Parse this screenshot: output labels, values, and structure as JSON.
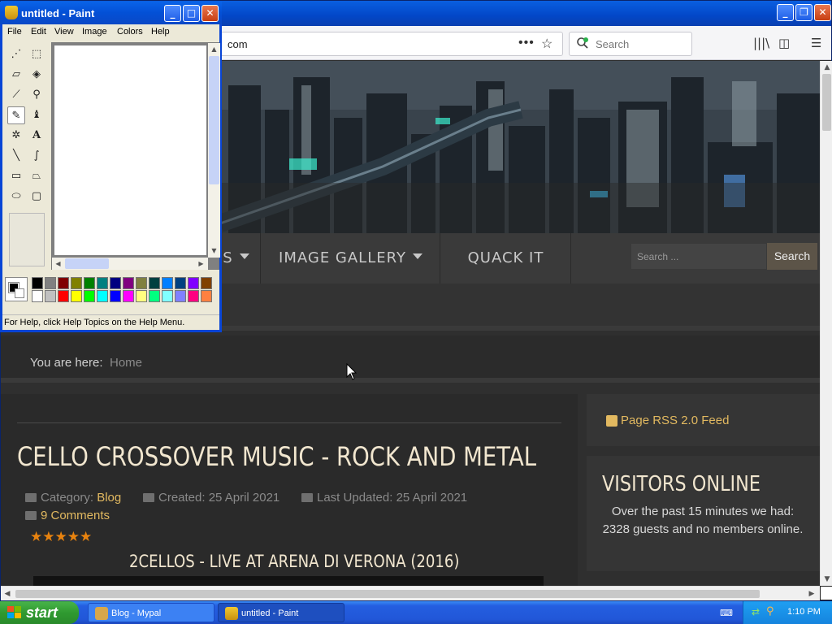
{
  "browser": {
    "url": "com",
    "search_placeholder": "Search"
  },
  "site": {
    "nav": [
      {
        "label": "S",
        "has_dropdown": true
      },
      {
        "label": "IMAGE GALLERY",
        "has_dropdown": true
      },
      {
        "label": "QUACK IT",
        "has_dropdown": false
      }
    ],
    "search_placeholder": "Search ...",
    "search_button": "Search",
    "breadcrumb": {
      "prefix": "You are here:",
      "home": "Home"
    },
    "article": {
      "title": "CELLO CROSSOVER MUSIC - ROCK AND METAL",
      "category_label": "Category:",
      "category_value": "Blog",
      "created": "Created: 25 April 2021",
      "updated": "Last Updated: 25 April 2021",
      "comments": "9 Comments",
      "rating_stars": 5,
      "video_title": "2CELLOS - LIVE AT ARENA DI VERONA (2016)"
    },
    "sidebar": {
      "rss": "Page RSS 2.0 Feed",
      "visitors_title": "VISITORS ONLINE",
      "visitors_text": "Over the past 15 minutes we had: 2328 guests and no members online."
    }
  },
  "paint": {
    "title": "untitled - Paint",
    "menu": [
      "File",
      "Edit",
      "View",
      "Image",
      "Colors",
      "Help"
    ],
    "status": "For Help, click Help Topics on the Help Menu.",
    "palette_top": [
      "#000000",
      "#808080",
      "#800000",
      "#808000",
      "#008000",
      "#008080",
      "#000080",
      "#800080",
      "#808040",
      "#004040",
      "#0080ff",
      "#004080",
      "#8000ff",
      "#804000"
    ],
    "palette_bottom": [
      "#ffffff",
      "#c0c0c0",
      "#ff0000",
      "#ffff00",
      "#00ff00",
      "#00ffff",
      "#0000ff",
      "#ff00ff",
      "#ffff80",
      "#00ff80",
      "#80ffff",
      "#8080ff",
      "#ff0080",
      "#ff8040"
    ]
  },
  "taskbar": {
    "start": "start",
    "tasks": [
      "Blog - Mypal",
      "untitled - Paint"
    ],
    "clock": "1:10 PM"
  }
}
